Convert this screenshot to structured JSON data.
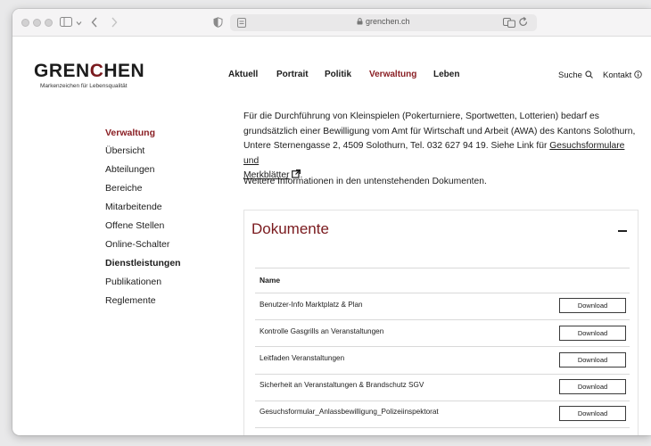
{
  "browser": {
    "url": "grenchen.ch"
  },
  "site": {
    "logo_text_before": "GREN",
    "logo_text_c": "C",
    "logo_text_after": "HEN",
    "tagline": "Markenzeichen für Lebensqualität"
  },
  "main_nav": [
    {
      "label": "Aktuell"
    },
    {
      "label": "Portrait"
    },
    {
      "label": "Politik"
    },
    {
      "label": "Verwaltung"
    },
    {
      "label": "Leben"
    }
  ],
  "utility_nav": {
    "search": "Suche",
    "contact": "Kontakt"
  },
  "side_nav": {
    "heading": "Verwaltung",
    "items": [
      {
        "label": "Übersicht"
      },
      {
        "label": "Abteilungen"
      },
      {
        "label": "Bereiche"
      },
      {
        "label": "Mitarbeitende"
      },
      {
        "label": "Offene Stellen"
      },
      {
        "label": "Online-Schalter"
      },
      {
        "label": "Dienstleistungen"
      },
      {
        "label": "Publikationen"
      },
      {
        "label": "Reglemente"
      }
    ]
  },
  "content": {
    "para1_line1": "Für die Durchführung von Kleinspielen (Pokerturniere, Sportwetten, Lotterien) bedarf es",
    "para1_line2": "grundsätzlich einer Bewilligung vom Amt für Wirtschaft und Arbeit (AWA) des Kantons Solothurn,",
    "para1_line3_text": "Untere Sternengasse 2, 4509 Solothurn, Tel. 032 627 94 19. Siehe Link für ",
    "para1_line3_link": "Gesuchsformulare und",
    "para1_line4_link": "Merkblätter",
    "para1_line4_end": ".",
    "para2": "Weitere Informationen in den untenstehenden Dokumenten."
  },
  "documents": {
    "title": "Dokumente",
    "column_name": "Name",
    "rows": [
      {
        "name": "Benutzer-Info Marktplatz & Plan",
        "action": "Download"
      },
      {
        "name": "Kontrolle Gasgrills an Veranstaltungen",
        "action": "Download"
      },
      {
        "name": "Leitfaden Veranstaltungen",
        "action": "Download"
      },
      {
        "name": "Sicherheit an Veranstaltungen & Brandschutz SGV",
        "action": "Download"
      },
      {
        "name": "Gesuchsformular_Anlassbewilligung_Polizeiinspektorat",
        "action": "Download"
      }
    ]
  },
  "colors": {
    "brand": "#7a1a1e",
    "text": "#1c1c1c"
  }
}
